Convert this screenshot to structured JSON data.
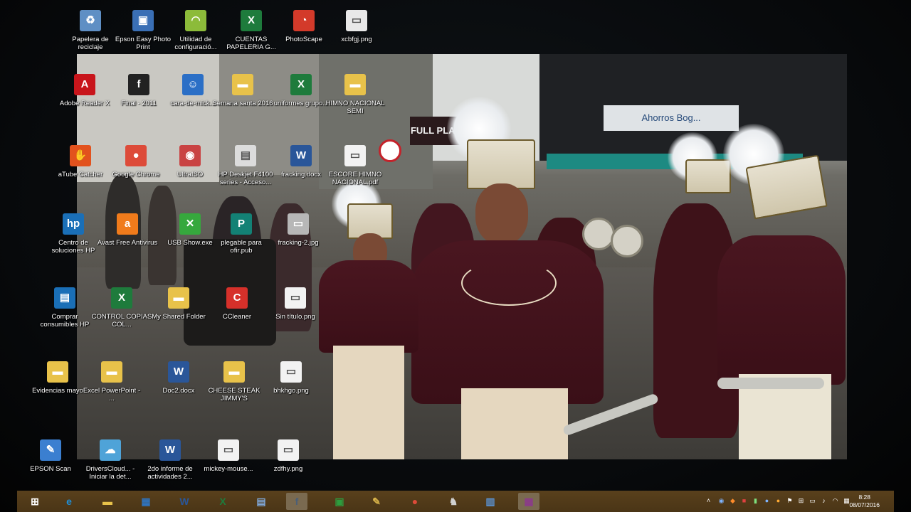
{
  "desktop": {
    "icons": [
      {
        "id": "recycle-bin",
        "label": "Papelera de reciclaje",
        "icon": "recycle-bin-icon",
        "color": "#5f8fc4",
        "glyph": "♻"
      },
      {
        "id": "epson-easy-photo-print",
        "label": "Epson Easy Photo Print",
        "icon": "photo-print-icon",
        "color": "#3a6fb5",
        "glyph": "▣"
      },
      {
        "id": "utilidad-config",
        "label": "Utilidad de configuració...",
        "icon": "wifi-icon",
        "color": "#8cbb3a",
        "glyph": "◠"
      },
      {
        "id": "cuentas-papeleria",
        "label": "CUENTAS PAPELERIA G...",
        "icon": "excel-file-icon",
        "color": "#1e7b3c",
        "glyph": "X"
      },
      {
        "id": "photoscape",
        "label": "PhotoScape",
        "icon": "photoscape-icon",
        "color": "#d33a2a",
        "glyph": "◔"
      },
      {
        "id": "xcbfgj",
        "label": "xcbfgj.png",
        "icon": "image-file-icon",
        "color": "#e8e8e8",
        "glyph": "▭"
      },
      {
        "id": "adobe-reader",
        "label": "Adobe Reader X",
        "icon": "pdf-icon",
        "color": "#c8151b",
        "glyph": "A"
      },
      {
        "id": "final-2011",
        "label": "Final - 2011",
        "icon": "finale-icon",
        "color": "#222222",
        "glyph": "f"
      },
      {
        "id": "cara-mickey",
        "label": "cara-de-mick...",
        "icon": "image-file-icon",
        "color": "#2b6fc6",
        "glyph": "☺"
      },
      {
        "id": "semana-santa",
        "label": "Semana santa 2016",
        "icon": "folder-icon",
        "color": "#e8c24a",
        "glyph": "▬"
      },
      {
        "id": "uniformes",
        "label": "uniformes grupo...",
        "icon": "excel-file-icon",
        "color": "#1e7b3c",
        "glyph": "X"
      },
      {
        "id": "himno-nacional",
        "label": "HIMNO NACIONAL SEMI",
        "icon": "folder-icon",
        "color": "#e8c24a",
        "glyph": "▬"
      },
      {
        "id": "atube-catcher",
        "label": "aTube Catcher",
        "icon": "atube-icon",
        "color": "#e2521d",
        "glyph": "✋"
      },
      {
        "id": "google-chrome",
        "label": "Google Chrome",
        "icon": "chrome-icon",
        "color": "#dd4b39",
        "glyph": "●"
      },
      {
        "id": "ultraiso",
        "label": "UltraISO",
        "icon": "disc-icon",
        "color": "#c94343",
        "glyph": "◉"
      },
      {
        "id": "hp-deskjet",
        "label": "HP Deskjet F4100 series - Acceso...",
        "icon": "printer-icon",
        "color": "#dcdcdc",
        "glyph": "▤"
      },
      {
        "id": "fracking-docx",
        "label": "fracking.docx",
        "icon": "word-file-icon",
        "color": "#2a5699",
        "glyph": "W"
      },
      {
        "id": "escore-himno",
        "label": "ESCORE HIMNO NACIONAL.pdf",
        "icon": "pdf-file-icon",
        "color": "#f2f2f2",
        "glyph": "▭"
      },
      {
        "id": "centro-soluciones-hp",
        "label": "Centro de soluciones HP",
        "icon": "hp-icon",
        "color": "#1a6fb7",
        "glyph": "hp"
      },
      {
        "id": "avast",
        "label": "Avast Free Antivirus",
        "icon": "avast-icon",
        "color": "#f07b1b",
        "glyph": "a"
      },
      {
        "id": "usb-show",
        "label": "USB Show.exe",
        "icon": "usb-show-icon",
        "color": "#36a83d",
        "glyph": "✕"
      },
      {
        "id": "plegable",
        "label": "plegable para ofir.pub",
        "icon": "publisher-file-icon",
        "color": "#138175",
        "glyph": "P"
      },
      {
        "id": "fracking-2",
        "label": "fracking-2.jpg",
        "icon": "image-file-icon",
        "color": "#b7b7b7",
        "glyph": "▭"
      },
      {
        "id": "comprar-consumibles",
        "label": "Comprar consumibles HP",
        "icon": "hp-ink-icon",
        "color": "#1a6fb7",
        "glyph": "▤"
      },
      {
        "id": "control-copias",
        "label": "CONTROL COPIAS COL...",
        "icon": "excel-file-icon",
        "color": "#1e7b3c",
        "glyph": "X"
      },
      {
        "id": "my-shared-folder",
        "label": "My Shared Folder",
        "icon": "folder-icon",
        "color": "#e8c24a",
        "glyph": "▬"
      },
      {
        "id": "ccleaner",
        "label": "CCleaner",
        "icon": "ccleaner-icon",
        "color": "#d6302a",
        "glyph": "C"
      },
      {
        "id": "sin-titulo",
        "label": "Sin título.png",
        "icon": "image-file-icon",
        "color": "#f2f2f2",
        "glyph": "▭"
      },
      {
        "id": "evidencias-mayo",
        "label": "Evidencias mayo",
        "icon": "folder-icon",
        "color": "#e8c24a",
        "glyph": "▬"
      },
      {
        "id": "excel-powerpoint",
        "label": "Excel PowerPoint - ...",
        "icon": "folder-icon",
        "color": "#e8c24a",
        "glyph": "▬"
      },
      {
        "id": "doc2",
        "label": "Doc2.docx",
        "icon": "word-file-icon",
        "color": "#2a5699",
        "glyph": "W"
      },
      {
        "id": "cheese-steak",
        "label": "CHEESE STEAK JIMMY'S",
        "icon": "folder-icon",
        "color": "#e8c24a",
        "glyph": "▬"
      },
      {
        "id": "bhkhgo",
        "label": "bhkhgo.png",
        "icon": "image-file-icon",
        "color": "#f2f2f2",
        "glyph": "▭"
      },
      {
        "id": "epson-scan",
        "label": "EPSON Scan",
        "icon": "scanner-icon",
        "color": "#3b7fd0",
        "glyph": "✎"
      },
      {
        "id": "driverscloud",
        "label": "DriversCloud... - Iniciar la det...",
        "icon": "driverscloud-icon",
        "color": "#4fa3d8",
        "glyph": "☁"
      },
      {
        "id": "2do-informe",
        "label": "2do informe de actividades 2...",
        "icon": "word-file-icon",
        "color": "#2a5699",
        "glyph": "W"
      },
      {
        "id": "mickey-mouse",
        "label": "mickey-mouse...",
        "icon": "image-file-icon",
        "color": "#f2f2f2",
        "glyph": "▭"
      },
      {
        "id": "zdfhy",
        "label": "zdfhy.png",
        "icon": "image-file-icon",
        "color": "#f2f2f2",
        "glyph": "▭"
      }
    ]
  },
  "wallpaper": {
    "signs": {
      "full_play": "FULL PLAY",
      "ahorros": "Ahorros Bog..."
    }
  },
  "taskbar": {
    "start_icon": "windows-start-icon",
    "apps": [
      {
        "id": "start",
        "icon": "windows-start-icon",
        "color": "#ffffff",
        "glyph": "⊞"
      },
      {
        "id": "ie",
        "icon": "internet-explorer-icon",
        "color": "#1f8fd6",
        "glyph": "e"
      },
      {
        "id": "explorer",
        "icon": "file-explorer-icon",
        "color": "#e8c24a",
        "glyph": "▬"
      },
      {
        "id": "hp-solution",
        "icon": "hp-solution-center-icon",
        "color": "#2f74c0",
        "glyph": "▦"
      },
      {
        "id": "word",
        "icon": "word-icon",
        "color": "#2a5699",
        "glyph": "W"
      },
      {
        "id": "excel",
        "icon": "excel-icon",
        "color": "#1e7b3c",
        "glyph": "X"
      },
      {
        "id": "notepad",
        "icon": "document-icon",
        "color": "#7fa7d8",
        "glyph": "▤"
      },
      {
        "id": "finale",
        "icon": "finale-icon",
        "color": "#4a5f78",
        "glyph": "f"
      },
      {
        "id": "store",
        "icon": "store-icon",
        "color": "#2d9d3e",
        "glyph": "▣"
      },
      {
        "id": "paint",
        "icon": "paint-icon",
        "color": "#d9b44a",
        "glyph": "✎"
      },
      {
        "id": "chrome",
        "icon": "chrome-icon",
        "color": "#dd4b39",
        "glyph": "●"
      },
      {
        "id": "inkscape",
        "icon": "penguin-icon",
        "color": "#d0d0d0",
        "glyph": "♞"
      },
      {
        "id": "network",
        "icon": "network-computer-icon",
        "color": "#5a93d4",
        "glyph": "▥"
      },
      {
        "id": "winrar",
        "icon": "winrar-icon",
        "color": "#8b3a8b",
        "glyph": "▦"
      }
    ],
    "clock": {
      "time": "8:28",
      "date": "08/07/2016"
    }
  }
}
